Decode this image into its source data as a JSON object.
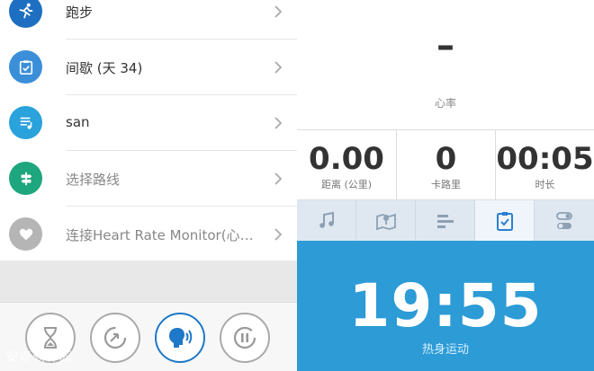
{
  "menu": {
    "items": [
      {
        "label": "跑步",
        "icon": "runner-icon",
        "color": "#1e6fc1"
      },
      {
        "label": "间歇 (天 34)",
        "icon": "checklist-icon",
        "color": "#3b8fd9"
      },
      {
        "label": "san",
        "icon": "music-note-icon",
        "color": "#2aa2db"
      },
      {
        "label": "选择路线",
        "icon": "signpost-icon",
        "color": "#1ea67e"
      },
      {
        "label": "连接Heart Rate Monitor(心率监测器)",
        "icon": "heart-icon",
        "color": "#b5b5b5"
      }
    ]
  },
  "controls": {
    "buttons": [
      "hourglass-icon",
      "rewind-icon",
      "voice-coach-icon",
      "pause-icon"
    ]
  },
  "watermark": "安卓软件园",
  "workout": {
    "heart_rate_value": "–",
    "heart_rate_label": "心率",
    "stats": [
      {
        "value": "0.00",
        "label": "距离 (公里)"
      },
      {
        "value": "0",
        "label": "卡路里"
      },
      {
        "value": "00:05",
        "label": "时长"
      }
    ],
    "tabs": [
      "music-icon",
      "map-icon",
      "stats-icon",
      "checklist-icon",
      "settings-toggle-icon"
    ],
    "timer_value": "19:55",
    "timer_label": "热身运动"
  },
  "colors": {
    "accent_blue": "#2c9bd6",
    "brand_blue": "#1e6fc1"
  }
}
